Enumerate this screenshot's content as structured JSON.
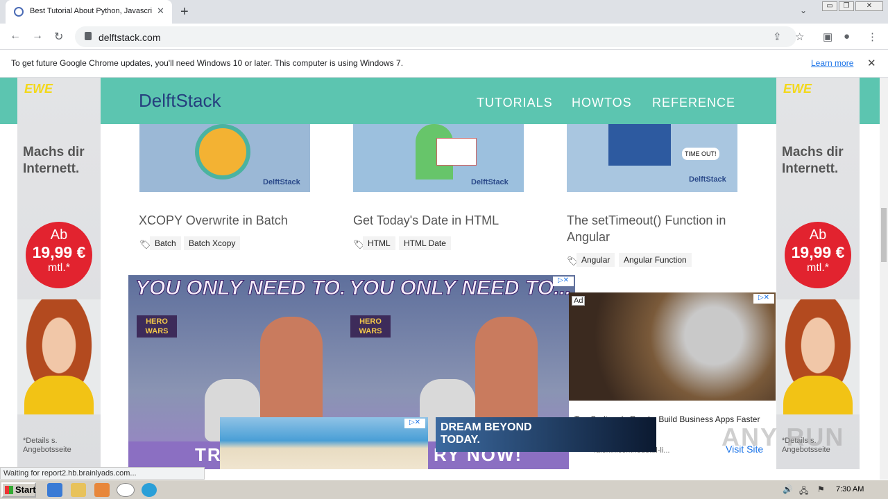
{
  "browser": {
    "tab_title": "Best Tutorial About Python, Javascri",
    "new_tab": "+",
    "tab_close": "✕",
    "url": "delftstack.com",
    "tab_search": "⌄",
    "window_buttons": [
      "▭",
      "❐",
      "✕"
    ]
  },
  "infobar": {
    "message": "To get future Google Chrome updates, you'll need Windows 10 or later. This computer is using Windows 7.",
    "link": "Learn more",
    "close": "✕"
  },
  "site": {
    "logo_prefix": "Delft",
    "logo_suffix": "Stack",
    "nav": [
      "TUTORIALS",
      "HOWTOS",
      "REFERENCE"
    ]
  },
  "side_ad": {
    "brand": "EWE",
    "headline_1": "Machs dir",
    "headline_2": "Internett.",
    "price_prefix": "Ab",
    "price": "19,99 €",
    "price_suffix": "mtl.*",
    "details_1": "*Details s.",
    "details_2": "Angebotsseite"
  },
  "cards": [
    {
      "title": "XCOPY Overwrite in Batch",
      "tags": [
        "Batch",
        "Batch Xcopy"
      ],
      "thumb_color": "#9bb8d6",
      "thumb_brand": "DelftStack"
    },
    {
      "title": "Get Today's Date in HTML",
      "tags": [
        "HTML",
        "HTML Date"
      ],
      "thumb_color": "#9cc0de",
      "thumb_brand": "DelftStack"
    },
    {
      "title": "The setTimeout() Function in",
      "title_2": "Angular",
      "tags": [
        "Angular",
        "Angular Function"
      ],
      "thumb_color": "#a9c6e0",
      "thumb_brand": "DelftStack",
      "thumb_text": "TIME OUT!"
    }
  ],
  "hero_ad": {
    "headline_left": "YOU ONLY NEED TO.",
    "headline_right": "YOU ONLY NEED TO...",
    "logo": "HERO WARS",
    "bottom_left": "TR",
    "bottom_right": "RY NOW!"
  },
  "side_display_ad": {
    "label": "Ad",
    "title": "Top Coding, Is Ready: Build Business Apps Faster",
    "url": "falenik.com/fedetul-li...",
    "cta": "Visit Site"
  },
  "dream_ad": {
    "line1": "DREAM BEYOND",
    "line2": "TODAY."
  },
  "status_text": "Waiting for report2.hb.brainlyads.com...",
  "taskbar": {
    "start": "Start",
    "clock": "7:30 AM"
  },
  "watermark": "ANY RUN"
}
